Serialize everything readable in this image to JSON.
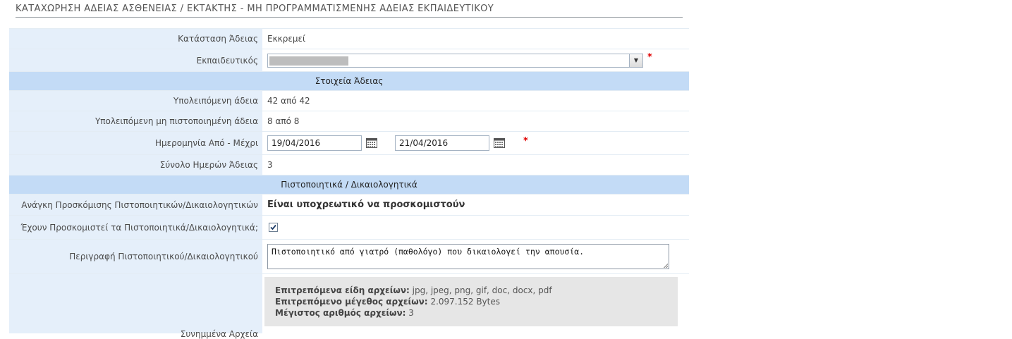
{
  "page": {
    "title": "ΚΑΤΑΧΩΡΗΣΗ ΑΔΕΙΑΣ ΑΣΘΕΝΕΙΑΣ / ΕΚΤΑΚΤΗΣ - ΜΗ ΠΡΟΓΡΑΜΜΑΤΙΣΜΕΝΗΣ ΑΔΕΙΑΣ ΕΚΠΑΙΔΕΥΤΙΚΟΥ"
  },
  "form": {
    "status": {
      "label": "Κατάσταση Άδειας",
      "value": "Εκκρεμεί"
    },
    "teacher": {
      "label": "Εκπαιδευτικός",
      "required_mark": "*"
    },
    "section_leave": "Στοιχεία Άδειας",
    "remaining": {
      "label": "Υπολειπόμενη άδεια",
      "value": "42 από 42"
    },
    "remaining_uncert": {
      "label": "Υπολειπόμενη μη πιστοποιημένη άδεια",
      "value": "8 από 8"
    },
    "dates": {
      "label": "Ημερομηνία Από - Μέχρι",
      "from": "19/04/2016",
      "to": "21/04/2016",
      "required_mark": "*"
    },
    "total_days": {
      "label": "Σύνολο Ημερών Άδειας",
      "value": "3"
    },
    "section_certs": "Πιστοποιητικά / Δικαιολογητικά",
    "need_certs": {
      "label": "Ανάγκη Προσκόμισης Πιστοποιητικών/Δικαιολογητικών",
      "value": "Είναι υποχρεωτικό να προσκομιστούν"
    },
    "certs_submitted": {
      "label": "Έχουν Προσκομιστεί τα Πιστοποιητικά/Δικαιολογητικά;",
      "checked": true
    },
    "cert_desc": {
      "label": "Περιγραφή Πιστοποιητικού/Δικαιολογητικού",
      "value": "Πιστοποιητικό από γιατρό (παθολόγο) που δικαιολογεί την απουσία."
    },
    "files": {
      "label": "Συνημμένα Αρχεία",
      "allowed_types_label": "Επιτρεπόμενα είδη αρχείων:",
      "allowed_types": "jpg, jpeg, png, gif, doc, docx, pdf",
      "max_size_label": "Επιτρεπόμενο μέγεθος αρχείων:",
      "max_size": "2.097.152 Bytes",
      "max_count_label": "Μέγιστος αριθμός αρχείων:",
      "max_count": "3"
    }
  },
  "icons": {
    "calendar": "calendar-icon",
    "dropdown": "chevron-down-icon",
    "check": "checkmark-icon"
  }
}
